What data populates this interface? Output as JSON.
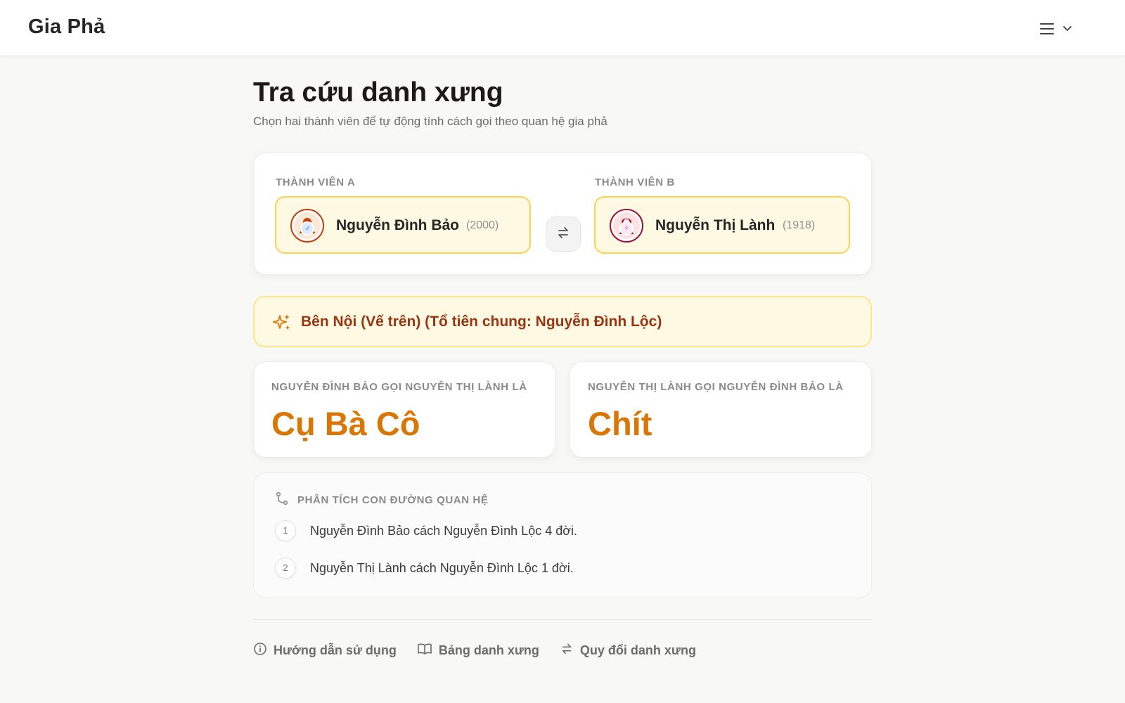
{
  "app": {
    "title": "Gia Phả"
  },
  "header": {
    "menu_icon": "hamburger-menu-icon",
    "chevron_icon": "chevron-down-icon"
  },
  "page": {
    "title": "Tra cứu danh xưng",
    "subtitle": "Chọn hai thành viên để tự động tính cách gọi theo quan hệ gia phả"
  },
  "member_a": {
    "label": "THÀNH VIÊN A",
    "name": "Nguyễn Đình Bảo",
    "year": "(2000)",
    "gender_symbol": "♂",
    "avatar_icon": "male-avatar-icon",
    "color": "#c2410c"
  },
  "member_b": {
    "label": "THÀNH VIÊN B",
    "name": "Nguyễn Thị Lành",
    "year": "(1918)",
    "gender_symbol": "♀",
    "avatar_icon": "female-avatar-icon",
    "color": "#9f1239"
  },
  "swap": {
    "icon": "swap-arrows-icon"
  },
  "result": {
    "icon": "sparkles-icon",
    "text": "Bên Nội (Vế trên) (Tổ tiên chung: Nguyễn Đình Lộc)"
  },
  "terms": [
    {
      "label": "NGUYỄN ĐÌNH BẢO GỌI NGUYỄN THỊ LÀNH LÀ",
      "value": "Cụ Bà Cô"
    },
    {
      "label": "NGUYỄN THỊ LÀNH GỌI NGUYỄN ĐÌNH BẢO LÀ",
      "value": "Chít"
    }
  ],
  "path_analysis": {
    "icon": "route-icon",
    "title": "PHÂN TÍCH CON ĐƯỜNG QUAN HỆ",
    "steps": [
      {
        "num": "1",
        "text": "Nguyễn Đình Bảo cách Nguyễn Đình Lộc 4 đời."
      },
      {
        "num": "2",
        "text": "Nguyễn Thị Lành cách Nguyễn Đình Lộc 1 đời."
      }
    ]
  },
  "footer": {
    "links": [
      {
        "label": "Hướng dẫn sử dụng",
        "icon": "info-icon"
      },
      {
        "label": "Bảng danh xưng",
        "icon": "book-icon"
      },
      {
        "label": "Quy đổi danh xưng",
        "icon": "swap-arrows-icon"
      }
    ]
  },
  "colors": {
    "accent": "#d97706",
    "banner_text": "#9a3412",
    "banner_bg": "#fef9e3",
    "banner_border": "#fde68a",
    "picker_border": "#fcd34d"
  }
}
